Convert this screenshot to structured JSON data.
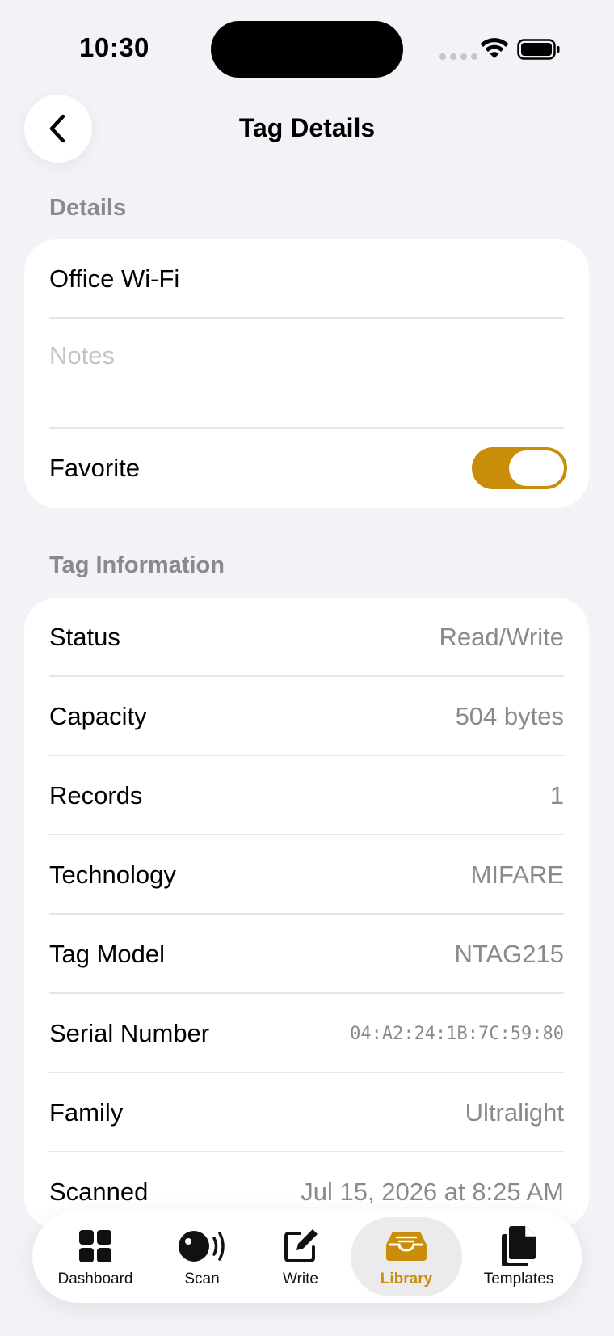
{
  "status_bar": {
    "time": "10:30"
  },
  "nav": {
    "title": "Tag Details"
  },
  "details": {
    "header": "Details",
    "name_value": "Office Wi-Fi",
    "notes_placeholder": "Notes",
    "favorite_label": "Favorite",
    "favorite_on": true
  },
  "tag_info": {
    "header": "Tag Information",
    "rows": [
      {
        "label": "Status",
        "value": "Read/Write"
      },
      {
        "label": "Capacity",
        "value": "504 bytes"
      },
      {
        "label": "Records",
        "value": "1"
      },
      {
        "label": "Technology",
        "value": "MIFARE"
      },
      {
        "label": "Tag Model",
        "value": "NTAG215"
      },
      {
        "label": "Serial Number",
        "value": "04:A2:24:1B:7C:59:80"
      },
      {
        "label": "Family",
        "value": "Ultralight"
      },
      {
        "label": "Scanned",
        "value": "Jul 15, 2026 at 8:25 AM"
      }
    ]
  },
  "tab_bar": {
    "items": [
      {
        "label": "Dashboard",
        "icon": "grid-icon"
      },
      {
        "label": "Scan",
        "icon": "scan-icon"
      },
      {
        "label": "Write",
        "icon": "write-icon"
      },
      {
        "label": "Library",
        "icon": "tray-icon"
      },
      {
        "label": "Templates",
        "icon": "documents-icon"
      }
    ],
    "active": "Library"
  },
  "colors": {
    "accent": "#c98d0a",
    "background": "#f2f2f7",
    "secondary_text": "#8a8a8e"
  }
}
